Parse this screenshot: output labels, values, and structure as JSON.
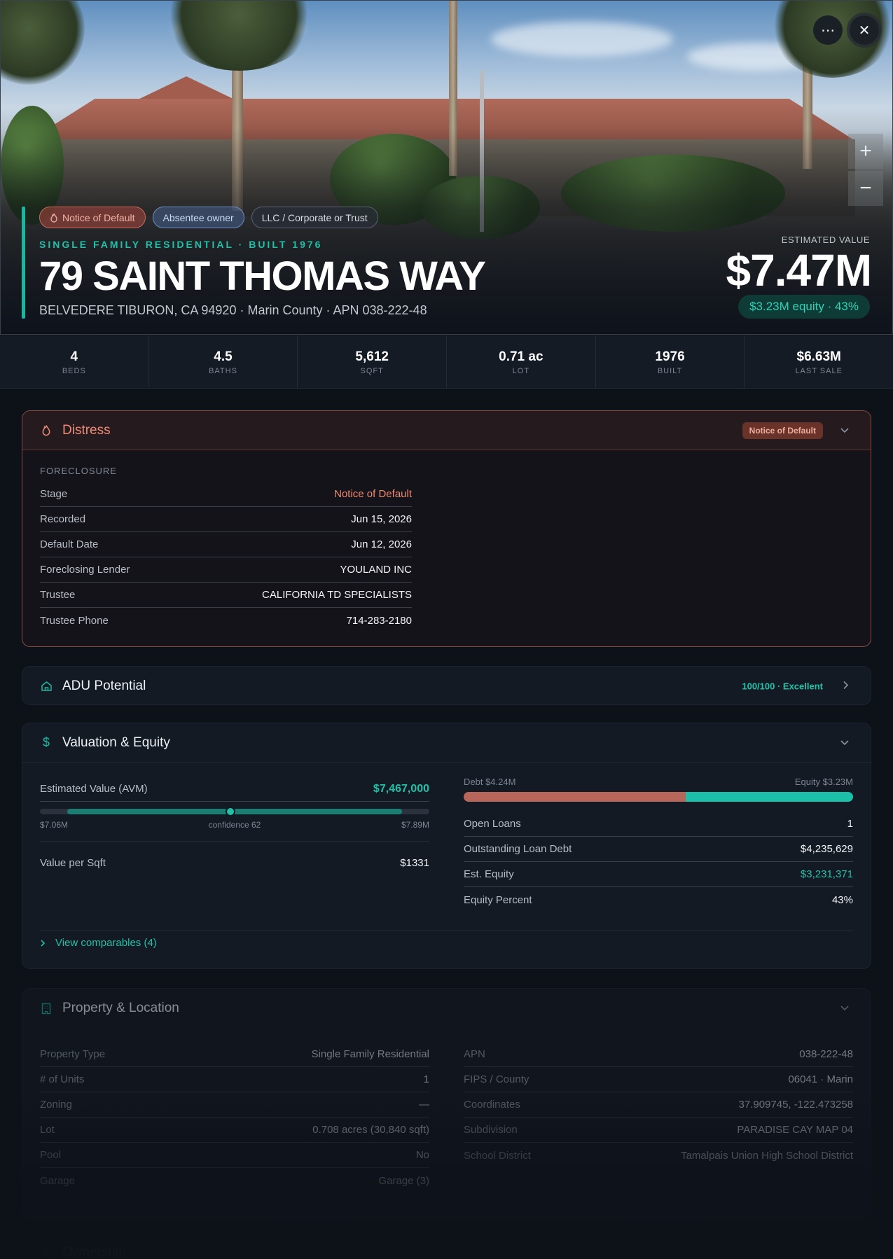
{
  "hero": {
    "tags": [
      {
        "label": "Notice of Default",
        "icon": "flame-icon"
      },
      {
        "label": "Absentee owner"
      },
      {
        "label": "LLC / Corporate or Trust"
      }
    ],
    "subtitle": "SINGLE FAMILY RESIDENTIAL · BUILT 1976",
    "address": "79 SAINT THOMAS WAY",
    "locality": "BELVEDERE TIBURON, CA 94920 · Marin County · APN 038-222-48",
    "estimated_value_label": "ESTIMATED VALUE",
    "estimated_value": "$7.47M",
    "equity_pill": "$3.23M equity · 43%",
    "more_icon": "⋯",
    "close_icon": "✕",
    "zoom_in": "+",
    "zoom_out": "−"
  },
  "stats": [
    {
      "value": "4",
      "label": "BEDS"
    },
    {
      "value": "4.5",
      "label": "BATHS"
    },
    {
      "value": "5,612",
      "label": "SQFT"
    },
    {
      "value": "0.71 ac",
      "label": "LOT"
    },
    {
      "value": "1976",
      "label": "BUILT"
    },
    {
      "value": "$6.63M",
      "label": "LAST SALE"
    }
  ],
  "distress": {
    "title": "Distress",
    "badge": "Notice of Default",
    "section": "FORECLOSURE",
    "rows": [
      {
        "k": "Stage",
        "v": "Notice of Default"
      },
      {
        "k": "Recorded",
        "v": "Jun 15, 2026"
      },
      {
        "k": "Default Date",
        "v": "Jun 12, 2026"
      },
      {
        "k": "Foreclosing Lender",
        "v": "YOULAND INC"
      },
      {
        "k": "Trustee",
        "v": "CALIFORNIA TD SPECIALISTS"
      },
      {
        "k": "Trustee Phone",
        "v": "714-283-2180"
      }
    ]
  },
  "adu": {
    "title": "ADU Potential",
    "badge": "100/100 · Excellent"
  },
  "valuation": {
    "title": "Valuation & Equity",
    "avm_label": "Estimated Value (AVM)",
    "avm_value": "$7,467,000",
    "range_low": "$7.06M",
    "confidence": "confidence 62",
    "range_high": "$7.89M",
    "value_sqft_label": "Value per Sqft",
    "value_sqft": "$1331",
    "debt_label": "Debt $4.24M",
    "equity_label": "Equity $3.23M",
    "debt_fraction": 0.57,
    "rows": [
      {
        "k": "Open Loans",
        "v": "1"
      },
      {
        "k": "Outstanding Loan Debt",
        "v": "$4,235,629"
      },
      {
        "k": "Est. Equity",
        "v": "$3,231,371"
      },
      {
        "k": "Equity Percent",
        "v": "43%"
      }
    ],
    "comparables": "View comparables (4)"
  },
  "property": {
    "title": "Property & Location",
    "left": [
      {
        "k": "Property Type",
        "v": "Single Family Residential"
      },
      {
        "k": "# of Units",
        "v": "1"
      },
      {
        "k": "Zoning",
        "v": "—"
      },
      {
        "k": "Lot",
        "v": "0.708 acres (30,840 sqft)"
      },
      {
        "k": "Pool",
        "v": "No"
      },
      {
        "k": "Garage",
        "v": "Garage (3)"
      }
    ],
    "right": [
      {
        "k": "APN",
        "v": "038-222-48"
      },
      {
        "k": "FIPS / County",
        "v": "06041 · Marin"
      },
      {
        "k": "Coordinates",
        "v": "37.909745, -122.473258"
      },
      {
        "k": "Subdivision",
        "v": "PARADISE CAY MAP 04"
      },
      {
        "k": "School District",
        "v": "Tamalpais Union High School District"
      }
    ]
  },
  "ownership": {
    "title": "Ownership"
  },
  "colors": {
    "accent": "#19b6a0",
    "distress": "#f08a74",
    "debt": "#b8665a",
    "equity": "#1cbfa8"
  }
}
